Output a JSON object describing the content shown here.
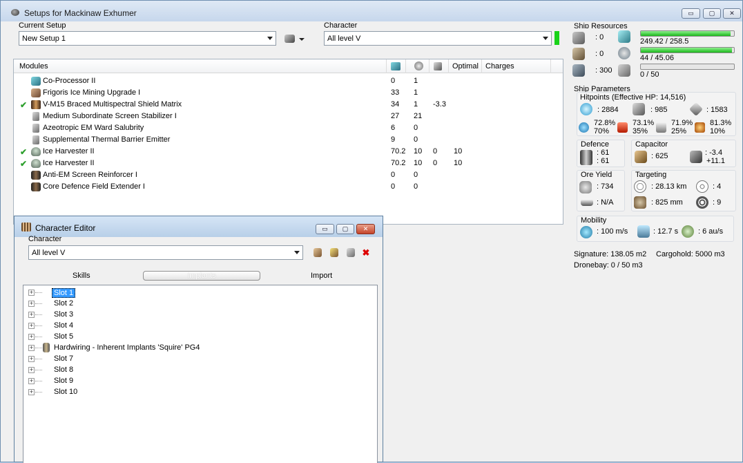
{
  "window": {
    "title": "Setups for Mackinaw Exhumer",
    "minimize": "▭",
    "maximize": "▢",
    "close": "✕"
  },
  "setup": {
    "current_setup_label": "Current Setup",
    "current_setup_value": "New Setup 1",
    "character_label": "Character",
    "character_value": "All level V"
  },
  "modules": {
    "headers": {
      "name": "Modules",
      "optimal": "Optimal",
      "charges": "Charges"
    },
    "rows": [
      {
        "check": "",
        "name": "Co-Processor II",
        "cpu": "0",
        "pg": "1",
        "cal": "",
        "optimal": "",
        "charges": ""
      },
      {
        "check": "",
        "name": "Frigoris Ice Mining Upgrade I",
        "cpu": "33",
        "pg": "1",
        "cal": "",
        "optimal": "",
        "charges": ""
      },
      {
        "check": "✔",
        "name": "V-M15 Braced Multispectral Shield Matrix",
        "cpu": "34",
        "pg": "1",
        "cal": "-3.3",
        "optimal": "",
        "charges": ""
      },
      {
        "check": "",
        "name": "Medium Subordinate Screen Stabilizer I",
        "cpu": "27",
        "pg": "21",
        "cal": "",
        "optimal": "",
        "charges": ""
      },
      {
        "check": "",
        "name": "Azeotropic EM Ward Salubrity",
        "cpu": "6",
        "pg": "0",
        "cal": "",
        "optimal": "",
        "charges": ""
      },
      {
        "check": "",
        "name": "Supplemental Thermal Barrier Emitter",
        "cpu": "9",
        "pg": "0",
        "cal": "",
        "optimal": "",
        "charges": ""
      },
      {
        "check": "✔",
        "name": "Ice Harvester II",
        "cpu": "70.2",
        "pg": "10",
        "cal": "0",
        "optimal": "10",
        "charges": ""
      },
      {
        "check": "✔",
        "name": "Ice Harvester II",
        "cpu": "70.2",
        "pg": "10",
        "cal": "0",
        "optimal": "10",
        "charges": ""
      },
      {
        "check": "",
        "name": "Anti-EM Screen Reinforcer I",
        "cpu": "0",
        "pg": "0",
        "cal": "",
        "optimal": "",
        "charges": ""
      },
      {
        "check": "",
        "name": "Core Defence Field Extender I",
        "cpu": "0",
        "pg": "0",
        "cal": "",
        "optimal": "",
        "charges": ""
      }
    ]
  },
  "resources": {
    "title": "Ship Resources",
    "turrets": ": 0",
    "launchers": ": 0",
    "drones": ": 300",
    "cpu": "249.42 / 258.5",
    "powergrid": "44 / 45.06",
    "calibration": "0 / 50",
    "cpu_fraction": 0.965,
    "pg_fraction": 0.976,
    "cal_fraction": 0.0
  },
  "parameters": {
    "title": "Ship Parameters",
    "hitpoints_label": "Hitpoints (Effective HP: 14,516)",
    "shield_hp": ": 2884",
    "armor_hp": ": 985",
    "hull_hp": ": 1583",
    "em_top": "72.8%",
    "em_bottom": "70%",
    "thermal_top": "73.1%",
    "thermal_bottom": "35%",
    "kinetic_top": "71.9%",
    "kinetic_bottom": "25%",
    "explosive_top": "81.3%",
    "explosive_bottom": "10%",
    "defence_label": "Defence",
    "defence_top": ": 61",
    "defence_bottom": ": 61",
    "capacitor_label": "Capacitor",
    "capacitor_value": ": 625",
    "cap_delta_top": ": -3.4",
    "cap_delta_bottom": "+11.1",
    "ore_yield_label": "Ore Yield",
    "ore_value": ": 734",
    "ice_value": ": N/A",
    "targeting_label": "Targeting",
    "target_range": ": 28.13 km",
    "scan_res": ": 825 mm",
    "max_targets": ": 4",
    "sensor_strength": ": 9",
    "mobility_label": "Mobility",
    "speed": ": 100 m/s",
    "align": ": 12.7 s",
    "warp": ": 6 au/s",
    "signature": "Signature: 138.05 m2",
    "cargohold": "Cargohold: 5000 m3",
    "dronebay": "Dronebay: 0 / 50 m3"
  },
  "char_editor": {
    "title": "Character Editor",
    "character_label": "Character",
    "character_value": "All level V",
    "tabs": {
      "skills": "Skills",
      "implants": "Implants",
      "import": "Import"
    },
    "slots": [
      {
        "label": "Slot 1",
        "selected": true,
        "icon": false
      },
      {
        "label": "Slot 2",
        "selected": false,
        "icon": false
      },
      {
        "label": "Slot 3",
        "selected": false,
        "icon": false
      },
      {
        "label": "Slot 4",
        "selected": false,
        "icon": false
      },
      {
        "label": "Slot 5",
        "selected": false,
        "icon": false
      },
      {
        "label": "Hardwiring - Inherent Implants 'Squire' PG4",
        "selected": false,
        "icon": true
      },
      {
        "label": "Slot 7",
        "selected": false,
        "icon": false
      },
      {
        "label": "Slot 8",
        "selected": false,
        "icon": false
      },
      {
        "label": "Slot 9",
        "selected": false,
        "icon": false
      },
      {
        "label": "Slot 10",
        "selected": false,
        "icon": false
      }
    ]
  },
  "colors": {
    "accent_green": "#19d219",
    "selection_blue": "#3399ff",
    "check_green": "#2ea02e"
  }
}
